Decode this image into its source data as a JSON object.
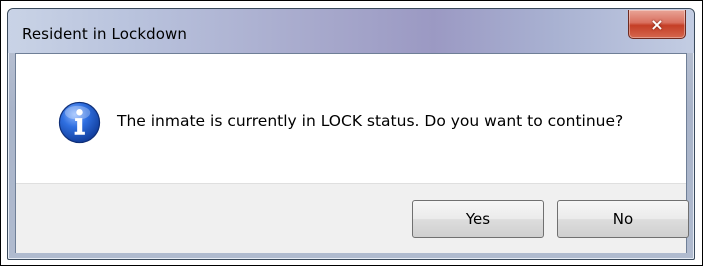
{
  "window": {
    "title": "Resident in Lockdown",
    "close_label": "×"
  },
  "message": {
    "icon": "information-icon",
    "text": "The inmate is currently in LOCK status.  Do you want to continue?"
  },
  "buttons": {
    "yes_label": "Yes",
    "no_label": "No"
  },
  "colors": {
    "close_button": "#c94a33",
    "info_icon": "#2458c4",
    "button_bar": "#f0f0f0"
  }
}
